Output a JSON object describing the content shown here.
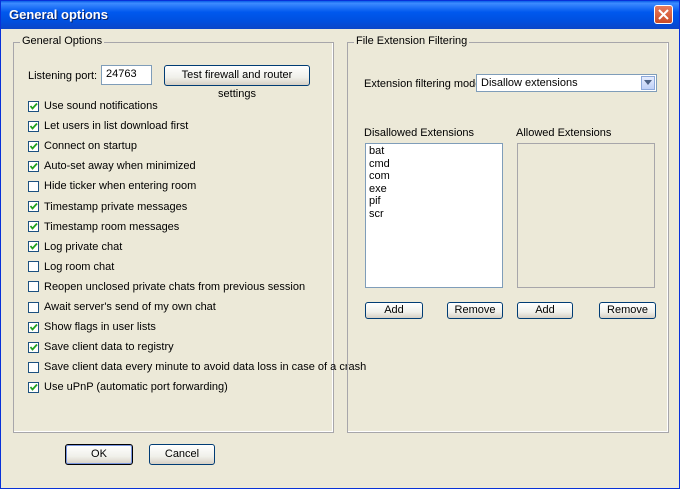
{
  "window": {
    "title": "General options"
  },
  "general": {
    "legend": "General Options",
    "port_label": "Listening port:",
    "port_value": "24763",
    "test_button": "Test firewall and router settings",
    "options": [
      {
        "label": "Use sound notifications",
        "checked": true
      },
      {
        "label": "Let users in list download first",
        "checked": true
      },
      {
        "label": "Connect on startup",
        "checked": true
      },
      {
        "label": "Auto-set away when minimized",
        "checked": true
      },
      {
        "label": "Hide ticker when entering room",
        "checked": false
      },
      {
        "label": "Timestamp private messages",
        "checked": true
      },
      {
        "label": "Timestamp room messages",
        "checked": true
      },
      {
        "label": "Log private chat",
        "checked": true
      },
      {
        "label": "Log room chat",
        "checked": false
      },
      {
        "label": "Reopen unclosed private chats from previous session",
        "checked": false
      },
      {
        "label": "Await server's send of my own chat",
        "checked": false
      },
      {
        "label": "Show flags in user lists",
        "checked": true
      },
      {
        "label": "Save client data to registry",
        "checked": true
      },
      {
        "label": "Save client data every minute to avoid data loss in case of a crash",
        "checked": false
      },
      {
        "label": "Use uPnP (automatic port forwarding)",
        "checked": true
      }
    ]
  },
  "filter": {
    "legend": "File Extension Filtering",
    "mode_label": "Extension filtering mode:",
    "mode_value": "Disallow extensions",
    "disallowed_label": "Disallowed Extensions",
    "allowed_label": "Allowed Extensions",
    "disallowed": [
      "bat",
      "cmd",
      "com",
      "exe",
      "pif",
      "scr"
    ],
    "allowed": [],
    "add_label": "Add",
    "remove_label": "Remove"
  },
  "footer": {
    "ok_label": "OK",
    "cancel_label": "Cancel"
  }
}
